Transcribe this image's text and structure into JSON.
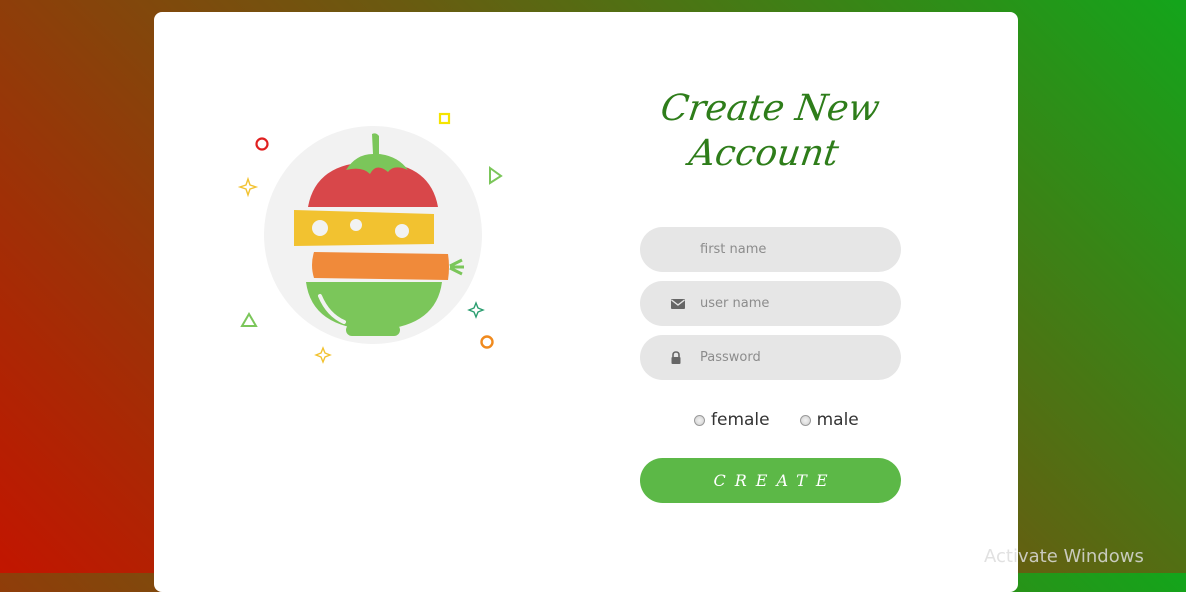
{
  "form": {
    "title_line1": "Create New",
    "title_line2": "Account",
    "first_name_placeholder": "first name",
    "user_name_placeholder": "user name",
    "password_placeholder": "Password",
    "gender_female": "female",
    "gender_male": "male",
    "create_label": "CREATE"
  },
  "watermark": "Activate Windows",
  "icons": {
    "logo": "food-stack-logo-icon",
    "user_name": "envelope-icon",
    "password": "lock-icon"
  },
  "colors": {
    "accent": "#5cb847",
    "title": "#2e7d1a",
    "field_bg": "#e6e6e6"
  }
}
